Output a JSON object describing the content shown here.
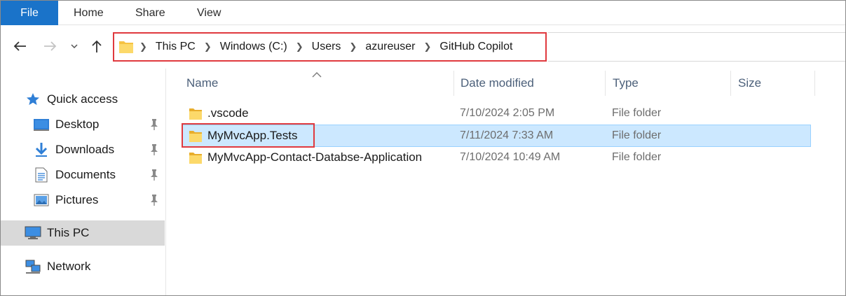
{
  "ribbon": {
    "tabs": [
      "File",
      "Home",
      "Share",
      "View"
    ]
  },
  "navigation": {
    "back_icon": "back-arrow-icon",
    "forward_icon": "forward-arrow-icon",
    "recent_icon": "chevron-down-icon",
    "up_icon": "up-arrow-icon"
  },
  "address_bar": {
    "breadcrumbs": [
      "This PC",
      "Windows (C:)",
      "Users",
      "azureuser",
      "GitHub Copilot"
    ]
  },
  "sidebar": {
    "items": [
      {
        "label": "Quick access",
        "icon": "star-icon"
      },
      {
        "label": "Desktop",
        "icon": "desktop-icon",
        "pinned": true
      },
      {
        "label": "Downloads",
        "icon": "download-icon",
        "pinned": true
      },
      {
        "label": "Documents",
        "icon": "document-icon",
        "pinned": true
      },
      {
        "label": "Pictures",
        "icon": "pictures-icon",
        "pinned": true
      },
      {
        "label": "This PC",
        "icon": "computer-icon",
        "selected": true
      },
      {
        "label": "Network",
        "icon": "network-icon"
      }
    ]
  },
  "file_list": {
    "columns": [
      "Name",
      "Date modified",
      "Type",
      "Size"
    ],
    "sorted_by": "Name",
    "rows": [
      {
        "name": ".vscode",
        "date_modified": "7/10/2024 2:05 PM",
        "type": "File folder",
        "size": "",
        "selected": false
      },
      {
        "name": "MyMvcApp.Tests",
        "date_modified": "7/11/2024 7:33 AM",
        "type": "File folder",
        "size": "",
        "selected": true
      },
      {
        "name": "MyMvcApp-Contact-Databse-Application",
        "date_modified": "7/10/2024 10:49 AM",
        "type": "File folder",
        "size": "",
        "selected": false
      }
    ]
  },
  "colors": {
    "file_tab": "#1a73c9",
    "selection": "#cce8ff",
    "annotation_box": "#e0393e",
    "folder": "#f5c242"
  }
}
